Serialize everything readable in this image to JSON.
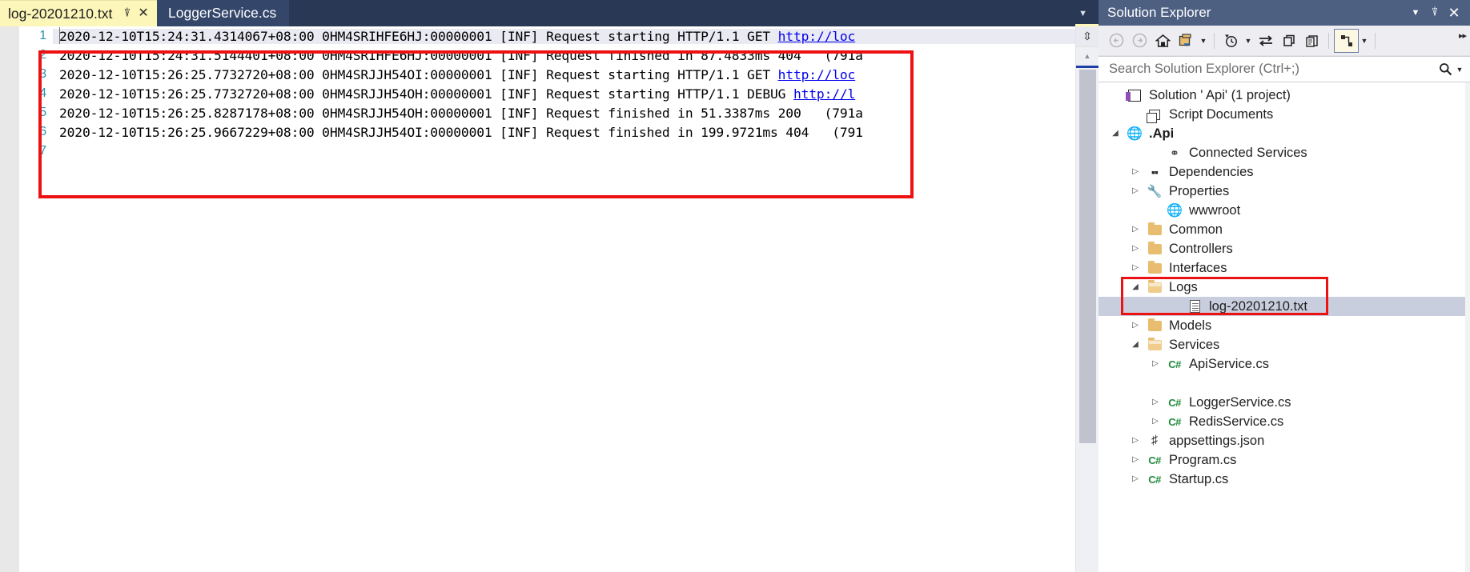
{
  "window": {
    "accent_red": "#ee1111",
    "tab_active_bg": "#fdf6b9",
    "panel_title_bg": "#4d6082"
  },
  "tabs": {
    "active": {
      "label": "log-20201210.txt",
      "pin_icon": "pin-icon",
      "close_icon": "close-icon"
    },
    "inactive": {
      "label": "LoggerService.cs"
    },
    "overflow_icon": "chevron-down-icon"
  },
  "editor": {
    "lines": [
      {
        "number": "1",
        "prefix": "2020-12-10T15:24:31.4314067+08:00 0HM4SRIHFE6HJ:00000001 [INF] Request starting HTTP/1.1 GET ",
        "link": "http://loc",
        "suffix": "",
        "current": true
      },
      {
        "number": "2",
        "prefix": "2020-12-10T15:24:31.5144401+08:00 0HM4SRIHFE6HJ:00000001 [INF] Request finished in 87.4833ms 404   (791a",
        "link": "",
        "suffix": "",
        "current": false
      },
      {
        "number": "3",
        "prefix": "2020-12-10T15:26:25.7732720+08:00 0HM4SRJJH54OI:00000001 [INF] Request starting HTTP/1.1 GET ",
        "link": "http://loc",
        "suffix": "",
        "current": false
      },
      {
        "number": "4",
        "prefix": "2020-12-10T15:26:25.7732720+08:00 0HM4SRJJH54OH:00000001 [INF] Request starting HTTP/1.1 DEBUG ",
        "link": "http://l",
        "suffix": "",
        "current": false
      },
      {
        "number": "5",
        "prefix": "2020-12-10T15:26:25.8287178+08:00 0HM4SRJJH54OH:00000001 [INF] Request finished in 51.3387ms 200   (791a",
        "link": "",
        "suffix": "",
        "current": false
      },
      {
        "number": "6",
        "prefix": "2020-12-10T15:26:25.9667229+08:00 0HM4SRJJH54OI:00000001 [INF] Request finished in 199.9721ms 404   (791",
        "link": "",
        "suffix": "",
        "current": false
      },
      {
        "number": "7",
        "prefix": "",
        "link": "",
        "suffix": "",
        "current": false
      }
    ],
    "scrollbar": {
      "split_icon": "split-pane-icon",
      "up_arrow_icon": "scroll-up-arrow-icon"
    }
  },
  "solution_explorer": {
    "title": "Solution Explorer",
    "title_buttons": {
      "chevron": "chevron-down-icon",
      "pin": "pin-icon",
      "close": "close-icon"
    },
    "toolbar": {
      "back": "back-arrow-icon",
      "forward": "forward-arrow-icon",
      "home": "home-icon",
      "new_window": "new-window-icon",
      "pending_changes": "pending-changes-clock-icon",
      "sync": "sync-with-active-document-icon",
      "refresh": "refresh-icon",
      "collapse_all": "collapse-all-icon",
      "show_all_files": "show-all-files-icon",
      "overflow": "toolbar-overflow-icon"
    },
    "search": {
      "placeholder": "Search Solution Explorer (Ctrl+;)",
      "value": "",
      "icon": "search-icon",
      "caret": "chevron-down-icon"
    },
    "tree": [
      {
        "label": "Solution '            Api' (1 project)",
        "indent": 0,
        "expander": "",
        "icon": "solution-icon",
        "bold": false,
        "selected": false
      },
      {
        "label": "Script Documents",
        "indent": 1,
        "expander": "",
        "icon": "script-documents-icon",
        "bold": false,
        "selected": false
      },
      {
        "label": ".Api",
        "indent": 0,
        "expander": "◢",
        "icon": "web-project-icon",
        "bold": true,
        "selected": false
      },
      {
        "label": "Connected Services",
        "indent": 2,
        "expander": "",
        "icon": "connected-services-icon",
        "bold": false,
        "selected": false
      },
      {
        "label": "Dependencies",
        "indent": 1,
        "expander": "▷",
        "icon": "dependencies-icon",
        "bold": false,
        "selected": false
      },
      {
        "label": "Properties",
        "indent": 1,
        "expander": "▷",
        "icon": "properties-wrench-icon",
        "bold": false,
        "selected": false
      },
      {
        "label": "wwwroot",
        "indent": 2,
        "expander": "",
        "icon": "wwwroot-globe-icon",
        "bold": false,
        "selected": false
      },
      {
        "label": "Common",
        "indent": 1,
        "expander": "▷",
        "icon": "folder-icon",
        "bold": false,
        "selected": false
      },
      {
        "label": "Controllers",
        "indent": 1,
        "expander": "▷",
        "icon": "folder-icon",
        "bold": false,
        "selected": false
      },
      {
        "label": "Interfaces",
        "indent": 1,
        "expander": "▷",
        "icon": "folder-icon",
        "bold": false,
        "selected": false
      },
      {
        "label": "Logs",
        "indent": 1,
        "expander": "◢",
        "icon": "folder-open-icon",
        "bold": false,
        "selected": false
      },
      {
        "label": "log-20201210.txt",
        "indent": 3,
        "expander": "",
        "icon": "text-file-icon",
        "bold": false,
        "selected": true
      },
      {
        "label": "Models",
        "indent": 1,
        "expander": "▷",
        "icon": "folder-icon",
        "bold": false,
        "selected": false
      },
      {
        "label": "Services",
        "indent": 1,
        "expander": "◢",
        "icon": "folder-open-icon",
        "bold": false,
        "selected": false
      },
      {
        "label": "ApiService.cs",
        "indent": 2,
        "expander": "▷",
        "icon": "csharp-file-icon",
        "bold": false,
        "selected": false
      },
      {
        "label": "",
        "indent": 2,
        "expander": "",
        "icon": "",
        "bold": false,
        "selected": false
      },
      {
        "label": "LoggerService.cs",
        "indent": 2,
        "expander": "▷",
        "icon": "csharp-file-icon",
        "bold": false,
        "selected": false
      },
      {
        "label": "RedisService.cs",
        "indent": 2,
        "expander": "▷",
        "icon": "csharp-file-icon",
        "bold": false,
        "selected": false
      },
      {
        "label": "appsettings.json",
        "indent": 1,
        "expander": "▷",
        "icon": "json-file-icon",
        "bold": false,
        "selected": false
      },
      {
        "label": "Program.cs",
        "indent": 1,
        "expander": "▷",
        "icon": "csharp-file-icon",
        "bold": false,
        "selected": false
      },
      {
        "label": "Startup.cs",
        "indent": 1,
        "expander": "▷",
        "icon": "csharp-file-icon",
        "bold": false,
        "selected": false
      }
    ]
  }
}
